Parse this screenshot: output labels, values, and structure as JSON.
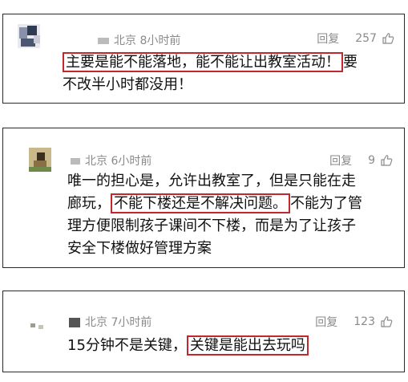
{
  "comments": [
    {
      "location": "北京",
      "time": "8小时前",
      "reply_label": "回复",
      "likes": "257",
      "lines": [
        "主要是能不能落地，能不能让出教室活动！",
        "要",
        "不改半小时都没用！"
      ]
    },
    {
      "location": "北京",
      "time": "6小时前",
      "reply_label": "回复",
      "likes": "9",
      "lines": [
        "唯一的担心是，允许出教室了，但是只能在走",
        "廊玩，",
        "不能下楼还是不解决问题。",
        "不能为了管",
        "理方便限制孩子课间不下楼，而是为了让孩子",
        "安全下楼做好管理方案"
      ]
    },
    {
      "location": "北京",
      "time": "7小时前",
      "reply_label": "回复",
      "likes": "123",
      "lines": [
        "15分钟不是关键，",
        "关键是能出去玩吗"
      ]
    }
  ],
  "colors": {
    "highlight": "#c0282d",
    "meta": "#8a8a8a",
    "border": "#2a2a2a"
  },
  "icons": {
    "like": "thumbs-up-icon"
  }
}
